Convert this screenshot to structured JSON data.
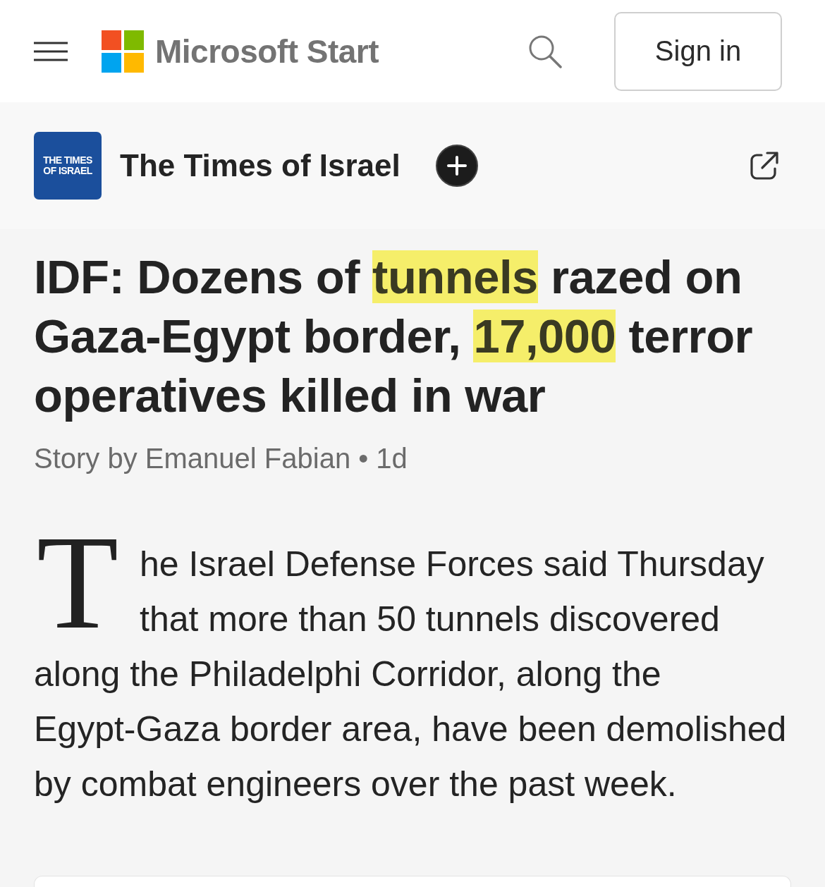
{
  "header": {
    "brand": "Microsoft Start",
    "sign_in": "Sign in"
  },
  "source": {
    "logo_text": "THE TIMES OF ISRAEL",
    "name": "The Times of Israel"
  },
  "article": {
    "headline": [
      {
        "text": "IDF: Dozens of ",
        "highlighted": false
      },
      {
        "text": "tunnels",
        "highlighted": true
      },
      {
        "text": " razed on Gaza-Egypt border, ",
        "highlighted": false
      },
      {
        "text": "17,000",
        "highlighted": true
      },
      {
        "text": " terror operatives killed in war",
        "highlighted": false
      }
    ],
    "byline": "Story by Emanuel Fabian • 1d",
    "body": "The Israel Defense Forces said Thursday that more than 50 tunnels discovered along the Philadelphi Corridor, along the Egypt-Gaza border area, have been demolished by combat engineers over the past week."
  }
}
